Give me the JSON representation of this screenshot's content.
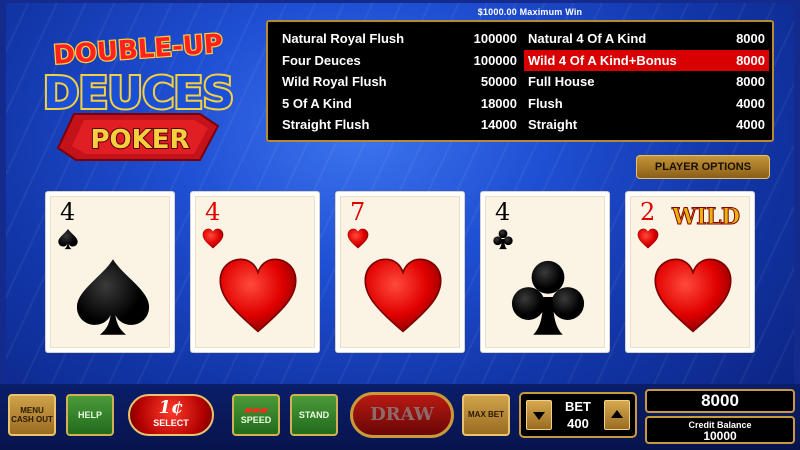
{
  "logo": {
    "line1": "DOUBLE-UP",
    "line2": "DEUCES",
    "line3": "POKER"
  },
  "max_win": "$1000.00 Maximum Win",
  "paytable": {
    "left": [
      {
        "hand": "Natural Royal Flush",
        "payout": "100000"
      },
      {
        "hand": "Four Deuces",
        "payout": "100000"
      },
      {
        "hand": "Wild Royal Flush",
        "payout": "50000"
      },
      {
        "hand": "5 Of A Kind",
        "payout": "18000"
      },
      {
        "hand": "Straight Flush",
        "payout": "14000"
      }
    ],
    "right": [
      {
        "hand": "Natural 4 Of A Kind",
        "payout": "8000"
      },
      {
        "hand": "Wild 4 Of A Kind+Bonus",
        "payout": "8000",
        "highlighted": true
      },
      {
        "hand": "Full House",
        "payout": "8000"
      },
      {
        "hand": "Flush",
        "payout": "4000"
      },
      {
        "hand": "Straight",
        "payout": "4000"
      }
    ],
    "highlight_color": "#d80000"
  },
  "player_options_label": "PLAYER OPTIONS",
  "cards": [
    {
      "rank": "4",
      "suit": "spades",
      "color": "#000000",
      "wild": ""
    },
    {
      "rank": "4",
      "suit": "hearts",
      "color": "#e00000",
      "wild": ""
    },
    {
      "rank": "7",
      "suit": "hearts",
      "color": "#e00000",
      "wild": ""
    },
    {
      "rank": "4",
      "suit": "clubs",
      "color": "#000000",
      "wild": ""
    },
    {
      "rank": "2",
      "suit": "hearts",
      "color": "#e00000",
      "wild": "WILD"
    }
  ],
  "controls": {
    "menu_label": "MENU CASH OUT",
    "help_label": "HELP",
    "denomination": "1¢",
    "select_label": "SELECT",
    "speed_label": "SPEED",
    "stand_label": "STAND",
    "draw_label": "DRAW",
    "max_bet_label": "MAX BET",
    "bet_label": "BET",
    "bet_value": "400",
    "win_amount": "8000",
    "credit_label": "Credit Balance",
    "credit_value": "10000"
  },
  "colors": {
    "background": "#1f4fd3",
    "gold_border": "#c89a3c",
    "heart_red": "#e00000"
  }
}
